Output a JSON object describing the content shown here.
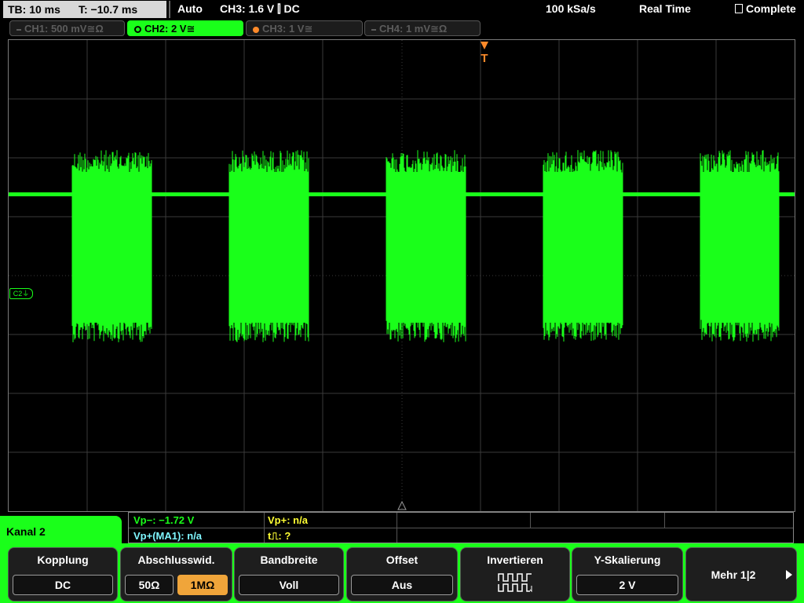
{
  "top": {
    "timebase": "TB: 10 ms",
    "trigger_time": "T: −10.7 ms",
    "mode": "Auto",
    "trigger_info": "CH3: 1.6 V ⫿ DC",
    "sample_rate": "100 kSa/s",
    "acq_mode": "Real Time",
    "status": "Complete"
  },
  "channels": [
    {
      "label": "CH1: 500 mV≅Ω",
      "active": false,
      "dot": ""
    },
    {
      "label": "CH2: 2 V≅",
      "active": true,
      "dot": "#1aff1a"
    },
    {
      "label": "CH3: 1 V≅",
      "active": false,
      "dot": "#ff8a2a"
    },
    {
      "label": "CH4: 1 mV≅Ω",
      "active": false,
      "dot": ""
    }
  ],
  "markers": {
    "trigger": "T",
    "ch2_ref": "C2⏚"
  },
  "measurements": {
    "vpminus": "Vp−: −1.72 V",
    "vpplus": "Vp+: n/a",
    "vpplus_ma1": "Vp+(MA1): n/a",
    "pulse": "t⎍: ?"
  },
  "menu": {
    "title": "Kanal 2",
    "softkeys": [
      {
        "title": "Kopplung",
        "value": "DC"
      },
      {
        "title": "Abschlusswid.",
        "options": [
          "50Ω",
          "1MΩ"
        ],
        "selected": 1
      },
      {
        "title": "Bandbreite",
        "value": "Voll"
      },
      {
        "title": "Offset",
        "value": "Aus"
      },
      {
        "title": "Invertieren",
        "icon": "invert-square-wave-icon"
      },
      {
        "title": "Y-Skalierung",
        "value": "2 V"
      },
      {
        "title": "Mehr 1|2"
      }
    ]
  },
  "colors": {
    "ch2": "#1aff1a",
    "ch3": "#ff8a2a",
    "trigger": "#ff8a2a",
    "selected_option": "#f0a53a",
    "measure_ch2": "#1aff1a",
    "measure_yellow": "#ffff33",
    "measure_cyan": "#7ff7ff"
  }
}
